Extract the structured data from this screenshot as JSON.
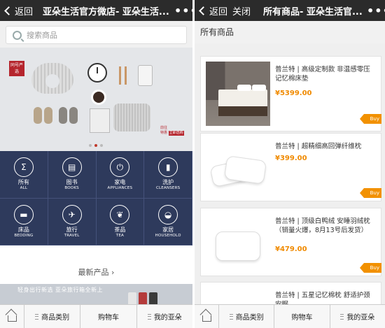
{
  "left": {
    "topbar": {
      "back_label": "返回",
      "title": "亚朵生活官方微店- 亚朵生活...",
      "more": "•••"
    },
    "search": {
      "placeholder": "搜索商品"
    },
    "banner": {
      "tag": "同号严选",
      "note_line1": "前往",
      "note_line2": "特惠",
      "note_button": "立即选购"
    },
    "categories": [
      {
        "zh": "所有",
        "en": "ALL",
        "icon": "sigma-icon",
        "glyph": "Σ"
      },
      {
        "zh": "图书",
        "en": "BOOKS",
        "icon": "book-icon",
        "glyph": "▤"
      },
      {
        "zh": "家电",
        "en": "APPLIANCES",
        "icon": "plug-icon",
        "glyph": "⏻"
      },
      {
        "zh": "洗护",
        "en": "CLEANSERS",
        "icon": "bottle-icon",
        "glyph": "▮"
      },
      {
        "zh": "床品",
        "en": "BEDDING",
        "icon": "bed-icon",
        "glyph": "▬"
      },
      {
        "zh": "旅行",
        "en": "TRAVEL",
        "icon": "plane-icon",
        "glyph": "✈"
      },
      {
        "zh": "茶品",
        "en": "TEA",
        "icon": "leaf-icon",
        "glyph": "❦"
      },
      {
        "zh": "家居",
        "en": "HOUSEHOLD",
        "icon": "slipper-icon",
        "glyph": "◒"
      }
    ],
    "section_new": "最新产品",
    "new_banner_text": "轻身出行新选 亚朵旅行箱全新上"
  },
  "right": {
    "topbar": {
      "back_label": "返回",
      "close_label": "关闭",
      "title": "所有商品- 亚朵生活官...",
      "more": "•••"
    },
    "subheader": "所有商品",
    "products": [
      {
        "title": "普兰特 | 高级定制款 非温感零压记忆棉床垫",
        "price": "¥5399.00",
        "buy": "Buy"
      },
      {
        "title": "普兰特 | 超精细高回弹纤维枕",
        "price": "¥399.00",
        "buy": "Buy"
      },
      {
        "title": "普兰特 | 顶级白鸭绒 安睡羽绒枕（销量火爆，8月13号后发货）",
        "price": "¥479.00",
        "buy": "Buy"
      },
      {
        "title": "普兰特 | 五星记忆棉枕 舒适护颈安眠",
        "price": "",
        "buy": ""
      }
    ]
  },
  "bottom_nav": {
    "categories": "商品类别",
    "cart": "购物车",
    "mine": "我的亚朵"
  },
  "colors": {
    "topbar": "#2b2b2b",
    "category_bg": "#2e3a5c",
    "price": "#f08a00",
    "buy": "#f29100"
  }
}
